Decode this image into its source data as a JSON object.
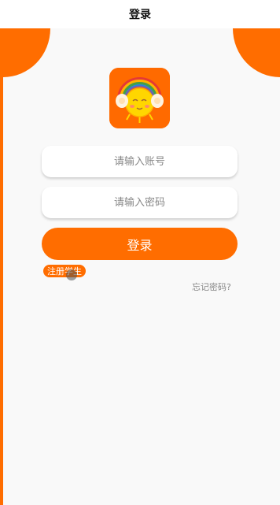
{
  "header": {
    "title": "登录"
  },
  "logo": {
    "icon": "sun-headphones-logo-icon"
  },
  "form": {
    "account_placeholder": "请输入账号",
    "password_placeholder": "请输入密码",
    "login_label": "登录",
    "register_label": "注册学生",
    "forgot_label": "忘记密码?"
  },
  "colors": {
    "accent": "#ff6d00",
    "background": "#f9f9f9",
    "input_bg": "#ffffff",
    "placeholder": "#888888"
  }
}
